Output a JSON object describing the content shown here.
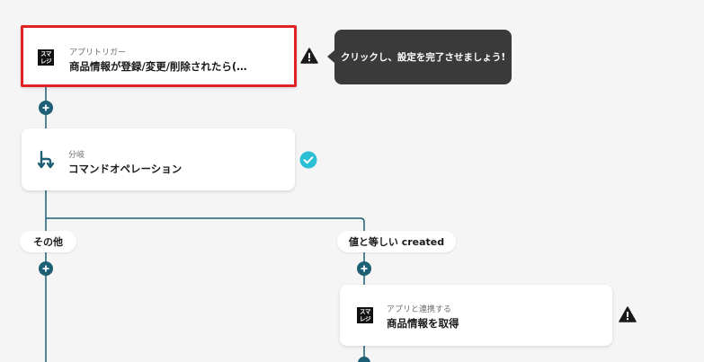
{
  "nodes": {
    "trigger": {
      "subtitle": "アプリトリガー",
      "title": "商品情報が登録/変更/削除されたら(…",
      "logo": [
        "スマ",
        "レジ"
      ]
    },
    "branch": {
      "subtitle": "分岐",
      "title": "コマンドオペレーション"
    },
    "action": {
      "subtitle": "アプリと連携する",
      "title": "商品情報を取得",
      "logo": [
        "スマ",
        "レジ"
      ]
    }
  },
  "tooltip": {
    "text": "クリックし、設定を完了させましょう!"
  },
  "branches": {
    "left_label": "その他",
    "right_label": "値と等しい created"
  },
  "icons": {
    "warning": "warning-triangle-icon",
    "check": "check-circle-icon",
    "branch": "branch-icon",
    "add": "plus-icon"
  },
  "colors": {
    "connector": "#1d5f74",
    "selected_border": "#e02424",
    "check": "#2bc0d6",
    "tooltip_bg": "#3a3a3a"
  }
}
